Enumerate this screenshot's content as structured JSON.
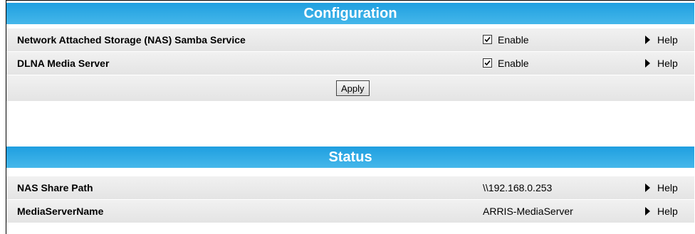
{
  "configuration": {
    "title": "Configuration",
    "rows": [
      {
        "label": "Network Attached Storage (NAS) Samba Service",
        "checkbox_label": "Enable",
        "checked": true,
        "help": "Help"
      },
      {
        "label": "DLNA Media Server",
        "checkbox_label": "Enable",
        "checked": true,
        "help": "Help"
      }
    ],
    "apply_label": "Apply"
  },
  "status": {
    "title": "Status",
    "rows": [
      {
        "label": "NAS Share Path",
        "value": "\\\\192.168.0.253",
        "help": "Help"
      },
      {
        "label": "MediaServerName",
        "value": "ARRIS-MediaServer",
        "help": "Help"
      }
    ]
  },
  "colors": {
    "header_gradient_top": "#1f9fe0",
    "header_gradient_bottom": "#45b7ea",
    "row_background": "#ececec"
  }
}
